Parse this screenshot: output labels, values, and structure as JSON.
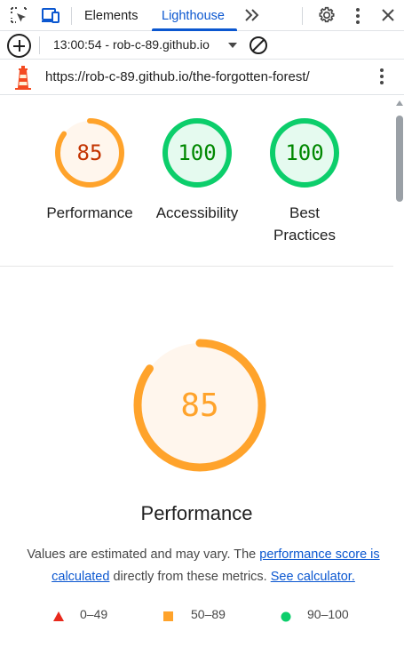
{
  "tabbar": {
    "tabs": [
      {
        "label": "Elements",
        "active": false
      },
      {
        "label": "Lighthouse",
        "active": true
      }
    ],
    "accent": "#0b57d0"
  },
  "toolbar": {
    "report_selector": "13:00:54 - rob-c-89.github.io"
  },
  "urlbar": {
    "url": "https://rob-c-89.github.io/the-forgotten-forest/"
  },
  "summary_gauges": [
    {
      "score": "85",
      "label": "Performance",
      "value": 0.85,
      "status": "average"
    },
    {
      "score": "100",
      "label": "Accessibility",
      "value": 1.0,
      "status": "pass"
    },
    {
      "score": "100",
      "label": "Best Practices",
      "value": 1.0,
      "status": "pass"
    }
  ],
  "performance": {
    "score": "85",
    "value": 0.85,
    "title": "Performance",
    "desc_prefix": "Values are estimated and may vary. The ",
    "desc_link": "performance score is calculated",
    "desc_middle": " directly from these metrics. ",
    "calculator_link": "See calculator."
  },
  "legend": [
    {
      "range": "0–49",
      "shape": "triangle",
      "color": "#e8291c"
    },
    {
      "range": "50–89",
      "shape": "square",
      "color": "#ffa32b"
    },
    {
      "range": "90–100",
      "shape": "circle",
      "color": "#0cce6b"
    }
  ],
  "colors": {
    "average_stroke": "#ffa32b",
    "average_fill": "#fff6ed",
    "average_text": "#c33300",
    "pass_stroke": "#0cce6b",
    "pass_fill": "#e5faef",
    "pass_text": "#008800"
  }
}
